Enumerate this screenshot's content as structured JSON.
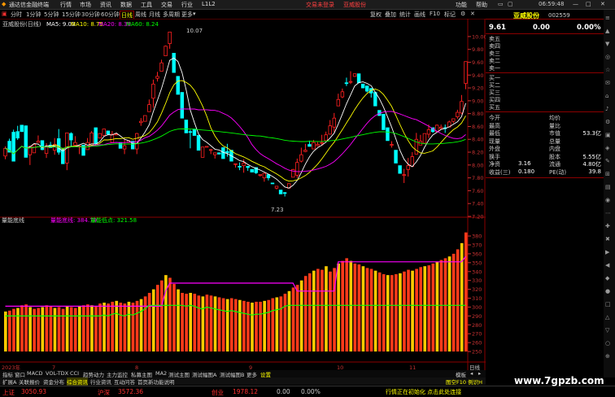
{
  "app": {
    "title": "通达信金融终端",
    "menu": [
      "行情",
      "市场",
      "资讯",
      "数据",
      "工具",
      "交易",
      "行业",
      "L1L2"
    ],
    "badges": [
      "交易未登录",
      "亚威股份"
    ],
    "right_menu": [
      "功能",
      "帮助"
    ],
    "time": "06:59:48"
  },
  "periods": [
    "分时",
    "1分钟",
    "5分钟",
    "15分钟",
    "30分钟",
    "60分钟",
    "日线",
    "周线",
    "月线",
    "多周期",
    "更多"
  ],
  "toolbar": [
    "复权",
    "叠加",
    "统计",
    "画线",
    "F10",
    "标记"
  ],
  "chart": {
    "caption": "亚威股份(日线)",
    "ma_items": [
      {
        "label": "MA5: 9.03",
        "color": "#ffffff"
      },
      {
        "label": "MA10: 8.75",
        "color": "#ffff00"
      },
      {
        "label": "MA20: 8.39",
        "color": "#ff00ff"
      },
      {
        "label": "MA60: 8.24",
        "color": "#00ff00"
      }
    ],
    "high_label": "10.07",
    "low_label": "7.23",
    "y_ticks": [
      "10.00",
      "9.80",
      "9.60",
      "9.40",
      "9.20",
      "9.00",
      "8.80",
      "8.60",
      "8.40",
      "8.20",
      "8.00",
      "7.80",
      "7.60",
      "7.40",
      "7.20"
    ]
  },
  "indicator": {
    "name": "量能底线",
    "items": [
      {
        "label": "量能底线: 384.79",
        "color": "#ff00ff"
      },
      {
        "label": "量能低点: 321.58",
        "color": "#00ff00"
      }
    ],
    "y_ticks": [
      "380",
      "370",
      "360",
      "350",
      "340",
      "330",
      "320",
      "310",
      "300",
      "290",
      "280",
      "270",
      "260",
      "250"
    ]
  },
  "xaxis": {
    "labels": [
      "2023年",
      "7",
      "8",
      "9",
      "10",
      "11"
    ],
    "end_label": "日线"
  },
  "tabs1": [
    "指标",
    "窗口",
    "MACD",
    "VOL-TDX",
    "CCI",
    "趋势动力",
    "主力监控",
    "私募主图",
    "MA2",
    "测试主图",
    "测试幅图A",
    "测试幅图B",
    "更多",
    "设置"
  ],
  "tabs2": [
    "扩展A",
    "关联报价",
    "资金分布",
    "综合资讯",
    "行业资讯",
    "互动问答",
    "首页新功能说明"
  ],
  "quote": {
    "name": "亚威股份",
    "code": "002559",
    "price": "9.61",
    "change": "0.00",
    "change_pct": "0.00%",
    "asks": [
      "卖五",
      "卖四",
      "卖三",
      "卖二",
      "卖一"
    ],
    "bids": [
      "买一",
      "买二",
      "买三",
      "买四",
      "买五"
    ],
    "rows": [
      [
        "今开",
        "",
        "均价",
        ""
      ],
      [
        "最高",
        "",
        "量比",
        ""
      ],
      [
        "最低",
        "",
        "市值",
        "53.3亿"
      ],
      [
        "现量",
        "",
        "总量",
        ""
      ],
      [
        "外盘",
        "",
        "内盘",
        ""
      ],
      [
        "换手",
        "",
        "股本",
        "5.55亿"
      ],
      [
        "净资",
        "3.16",
        "流通",
        "4.80亿"
      ],
      [
        "收益(三)",
        "0.180",
        "PE(动)",
        "39.8"
      ]
    ]
  },
  "side_icons": [
    "≡",
    "▲",
    "▼",
    "◎",
    "☆",
    "✉",
    "⌂",
    "♪",
    "⚙",
    "▣",
    "◈",
    "✎",
    "⊞",
    "▤",
    "◉",
    "⋯",
    "✚",
    "✖",
    "▶",
    "◀",
    "◆",
    "●",
    "□",
    "△",
    "▽",
    "○",
    "⊕"
  ],
  "status": {
    "items": [
      {
        "label": "上证",
        "value": "3050.93",
        "color": "#ff3030"
      },
      {
        "label": "沪深",
        "value": "3572.36",
        "color": "#ff3030"
      },
      {
        "label": "创业",
        "value": "1978.12",
        "color": "#ff3030"
      }
    ],
    "change": "0.00",
    "pct": "0.00%",
    "msg": "行情正在初始化 点击此处连接",
    "site": "www.7gpzb.com",
    "notice": "图空F10 例识H"
  },
  "colors": {
    "up": "#ff2020",
    "down": "#00ffff",
    "frame": "#8b0000",
    "axis": "#c83232"
  },
  "chart_data": [
    {
      "type": "candlestick",
      "title": "亚威股份(日线)",
      "ylim": [
        7.15,
        10.1
      ],
      "series": [
        {
          "name": "MA5",
          "color": "#ffffff"
        },
        {
          "name": "MA10",
          "color": "#ffff00"
        },
        {
          "name": "MA20",
          "color": "#ff00ff"
        },
        {
          "name": "MA60",
          "color": "#00ff00"
        }
      ],
      "candles": [
        [
          8.14,
          8.26,
          8.09,
          8.29
        ],
        [
          8.37,
          8.2,
          8.31,
          8.41
        ],
        [
          8.51,
          8.06,
          8.5,
          8.55
        ],
        [
          8.52,
          8.42,
          8.39,
          8.61
        ],
        [
          8.62,
          8.52,
          8.66,
          8.41
        ],
        [
          8.61,
          8.12,
          8.66,
          8.1
        ],
        [
          8.16,
          8.29,
          8.0,
          8.3
        ],
        [
          8.19,
          8.32,
          8.22,
          8.31
        ],
        [
          8.35,
          8.37,
          8.36,
          8.46
        ],
        [
          8.38,
          8.24,
          8.23,
          8.3
        ],
        [
          8.18,
          8.28,
          8.11,
          8.34
        ],
        [
          8.31,
          8.27,
          8.27,
          8.36
        ],
        [
          8.23,
          8.32,
          8.16,
          8.42
        ],
        [
          8.41,
          8.2,
          8.16,
          8.56
        ],
        [
          8.24,
          8.02,
          8.22,
          8.1
        ],
        [
          8.03,
          8.5,
          7.92,
          8.49
        ],
        [
          8.49,
          8.39,
          8.28,
          8.51
        ],
        [
          8.31,
          8.35,
          8.3,
          8.45
        ],
        [
          8.29,
          8.3,
          8.17,
          8.31
        ],
        [
          8.31,
          8.15,
          8.3,
          8.13
        ],
        [
          8.24,
          8.35,
          8.31,
          8.42
        ],
        [
          8.3,
          8.5,
          8.32,
          8.53
        ],
        [
          8.58,
          8.33,
          8.53,
          8.27
        ],
        [
          8.42,
          8.49,
          8.55,
          8.39
        ],
        [
          8.46,
          8.56,
          8.59,
          8.51
        ],
        [
          8.53,
          8.48,
          8.51,
          8.5
        ],
        [
          8.35,
          8.48,
          8.35,
          8.53
        ],
        [
          8.48,
          8.48,
          8.57,
          8.5
        ],
        [
          8.35,
          8.26,
          8.4,
          8.25
        ],
        [
          8.25,
          8.3,
          8.17,
          8.4
        ],
        [
          8.35,
          8.38,
          8.44,
          8.34
        ],
        [
          8.37,
          8.25,
          8.32,
          8.3
        ],
        [
          8.25,
          8.49,
          8.17,
          8.5
        ],
        [
          8.66,
          8.68,
          8.61,
          8.73
        ],
        [
          8.68,
          8.77,
          8.68,
          8.76
        ],
        [
          8.83,
          8.94,
          8.88,
          9.02
        ],
        [
          9.04,
          9.26,
          8.89,
          9.33
        ],
        [
          9.35,
          9.38,
          9.3,
          9.45
        ],
        [
          9.46,
          9.59,
          9.52,
          9.64
        ],
        [
          9.7,
          9.85,
          9.71,
          9.86
        ],
        [
          9.89,
          10.07,
          9.81,
          10.07
        ],
        [
          9.74,
          9.44,
          9.85,
          9.52
        ],
        [
          9.38,
          9.1,
          9.31,
          9.17
        ],
        [
          9.13,
          8.73,
          9.06,
          8.89
        ],
        [
          8.7,
          8.5,
          8.5,
          8.39
        ],
        [
          8.52,
          8.51,
          8.26,
          8.55
        ],
        [
          8.56,
          8.46,
          8.59,
          8.44
        ],
        [
          8.46,
          8.23,
          8.45,
          8.15
        ],
        [
          8.12,
          8.28,
          8.32,
          8.27
        ],
        [
          8.28,
          8.29,
          8.37,
          8.24
        ],
        [
          8.23,
          8.24,
          8.17,
          8.25
        ],
        [
          8.16,
          8.19,
          8.1,
          8.16
        ],
        [
          8.19,
          8.17,
          8.23,
          8.05
        ],
        [
          8.27,
          8.1,
          8.29,
          8.15
        ],
        [
          8.21,
          8.19,
          8.13,
          8.33
        ],
        [
          8.23,
          8.06,
          8.28,
          7.94
        ],
        [
          8.01,
          8.02,
          7.96,
          7.99
        ],
        [
          7.98,
          7.97,
          7.92,
          8.04
        ],
        [
          7.99,
          8.03,
          7.88,
          8.09
        ],
        [
          7.98,
          7.96,
          7.91,
          7.95
        ],
        [
          7.93,
          7.89,
          8.01,
          7.88
        ],
        [
          7.96,
          7.88,
          7.86,
          7.94
        ],
        [
          7.85,
          7.85,
          7.82,
          7.83
        ],
        [
          7.8,
          7.87,
          7.74,
          7.88
        ],
        [
          7.85,
          7.8,
          7.76,
          7.72
        ],
        [
          7.72,
          7.71,
          7.81,
          7.69
        ],
        [
          7.64,
          7.67,
          7.62,
          7.64
        ],
        [
          7.61,
          7.55,
          7.65,
          7.5
        ],
        [
          7.57,
          7.56,
          7.51,
          7.58
        ],
        [
          7.64,
          7.71,
          7.72,
          7.7
        ],
        [
          7.81,
          7.93,
          7.81,
          7.94
        ],
        [
          7.84,
          8.04,
          7.8,
          8.1
        ],
        [
          8.06,
          8.16,
          8.04,
          8.27
        ],
        [
          8.21,
          8.23,
          8.2,
          8.33
        ],
        [
          8.32,
          8.29,
          8.3,
          8.38
        ],
        [
          8.25,
          8.35,
          8.26,
          8.39
        ],
        [
          8.3,
          8.32,
          8.29,
          8.36
        ],
        [
          8.35,
          8.35,
          8.3,
          8.47
        ],
        [
          8.38,
          8.47,
          8.41,
          8.52
        ],
        [
          8.48,
          8.61,
          8.48,
          8.7
        ],
        [
          8.59,
          8.73,
          8.51,
          8.81
        ],
        [
          8.92,
          9.02,
          8.94,
          9.11
        ],
        [
          9.06,
          9.14,
          9.04,
          9.19
        ],
        [
          9.28,
          9.27,
          9.23,
          9.36
        ],
        [
          9.29,
          9.3,
          9.26,
          9.46
        ],
        [
          9.38,
          9.42,
          9.37,
          9.42
        ],
        [
          9.42,
          9.28,
          9.41,
          9.29
        ],
        [
          9.26,
          9.2,
          9.32,
          9.17
        ],
        [
          9.23,
          9.15,
          9.13,
          9.18
        ],
        [
          9.19,
          9.12,
          9.05,
          9.2
        ],
        [
          9.13,
          8.92,
          9.1,
          8.97
        ],
        [
          8.85,
          8.77,
          8.9,
          8.76
        ],
        [
          8.79,
          8.55,
          8.69,
          8.47
        ],
        [
          8.58,
          8.38,
          8.63,
          8.29
        ],
        [
          8.31,
          8.32,
          8.27,
          8.37
        ],
        [
          8.23,
          8.03,
          8.29,
          7.95
        ],
        [
          7.99,
          7.87,
          8.04,
          7.86
        ],
        [
          7.84,
          7.85,
          7.72,
          7.94
        ],
        [
          7.93,
          7.99,
          7.82,
          8.11
        ],
        [
          7.98,
          8.13,
          8.11,
          8.2
        ],
        [
          8.17,
          8.4,
          8.18,
          8.5
        ],
        [
          8.31,
          8.37,
          8.31,
          8.47
        ],
        [
          8.34,
          8.49,
          8.37,
          8.48
        ],
        [
          8.48,
          8.55,
          8.42,
          8.63
        ],
        [
          8.58,
          8.52,
          8.5,
          8.56
        ],
        [
          8.52,
          8.62,
          8.59,
          8.63
        ],
        [
          8.57,
          8.59,
          8.55,
          8.63
        ],
        [
          8.58,
          8.57,
          8.5,
          8.63
        ],
        [
          8.59,
          8.67,
          8.6,
          8.69
        ],
        [
          8.68,
          8.72,
          8.65,
          8.72
        ],
        [
          8.75,
          8.82,
          8.72,
          8.86
        ],
        [
          8.81,
          8.99,
          8.79,
          9.09
        ],
        [
          9.27,
          9.61,
          9.18,
          9.61
        ]
      ]
    },
    {
      "type": "bar",
      "title": "量能底线",
      "ylim": [
        240,
        392
      ],
      "series": [
        {
          "name": "量能底线",
          "color": "#ff00ff",
          "values": [
            301,
            301,
            301,
            301,
            301,
            301,
            301,
            301,
            301,
            301,
            301,
            301,
            301,
            301,
            301,
            301,
            301,
            301,
            301,
            301,
            301,
            301,
            301,
            301,
            301,
            301,
            301,
            301,
            301,
            301,
            301,
            301,
            301,
            301,
            301,
            301,
            301,
            301,
            301,
            318,
            327,
            327,
            327,
            327,
            327,
            327,
            327,
            327,
            327,
            327,
            327,
            327,
            327,
            327,
            327,
            327,
            327,
            327,
            327,
            327,
            327,
            327,
            327,
            327,
            327,
            327,
            327,
            327,
            327,
            327,
            327,
            318,
            318,
            318,
            318,
            318,
            318,
            318,
            318,
            318,
            318,
            351,
            351,
            351,
            351,
            351,
            351,
            351,
            351,
            351,
            351,
            351,
            351,
            351,
            351,
            351,
            351,
            351,
            351,
            351,
            351,
            351,
            351,
            351,
            351,
            351,
            351,
            351,
            351,
            351,
            351,
            351,
            357
          ]
        },
        {
          "name": "量能低点",
          "color": "#00ff00",
          "values": [
            290,
            290,
            290,
            290,
            290,
            290,
            290,
            290,
            290,
            290,
            290,
            290,
            290,
            290,
            290,
            290,
            290,
            290,
            290,
            290,
            290,
            290,
            290,
            290,
            290,
            290,
            290,
            290,
            290,
            290,
            290,
            290,
            290,
            290,
            290,
            290,
            290,
            290,
            290,
            290,
            290,
            290,
            290,
            290,
            290,
            290,
            290,
            290,
            290,
            290,
            290,
            290,
            290,
            290,
            290,
            290,
            290,
            290,
            290,
            290,
            290,
            290,
            290,
            290,
            290,
            290,
            290,
            290,
            290,
            290,
            290,
            290,
            290,
            290,
            290,
            290,
            290,
            290,
            290,
            290,
            290,
            290,
            290,
            290,
            290,
            290,
            290,
            290,
            290,
            290,
            290,
            290,
            290,
            290,
            290,
            290,
            290,
            290,
            290,
            290,
            290,
            290,
            290,
            290,
            290,
            290,
            290,
            290,
            290,
            290,
            290,
            290,
            290
          ]
        },
        {
          "name": "量能",
          "color": "#ff2020",
          "values": [
            295,
            296,
            298,
            299,
            302,
            303,
            300,
            298,
            299,
            300,
            302,
            301,
            299,
            300,
            298,
            301,
            300,
            299,
            301,
            302,
            303,
            302,
            301,
            304,
            305,
            304,
            306,
            307,
            305,
            304,
            306,
            305,
            307,
            309,
            312,
            316,
            320,
            325,
            330,
            336,
            333,
            326,
            320,
            316,
            315,
            316,
            315,
            313,
            312,
            314,
            313,
            312,
            311,
            310,
            309,
            310,
            309,
            308,
            307,
            306,
            305,
            306,
            306,
            307,
            308,
            310,
            311,
            312,
            315,
            318,
            322,
            325,
            330,
            335,
            338,
            341,
            343,
            342,
            346,
            340,
            344,
            349,
            352,
            355,
            352,
            349,
            348,
            346,
            344,
            343,
            341,
            339,
            337,
            336,
            336,
            337,
            338,
            340,
            342,
            341,
            343,
            345,
            346,
            347,
            349,
            351,
            353,
            355,
            357,
            360,
            365,
            372,
            384
          ]
        }
      ]
    }
  ]
}
